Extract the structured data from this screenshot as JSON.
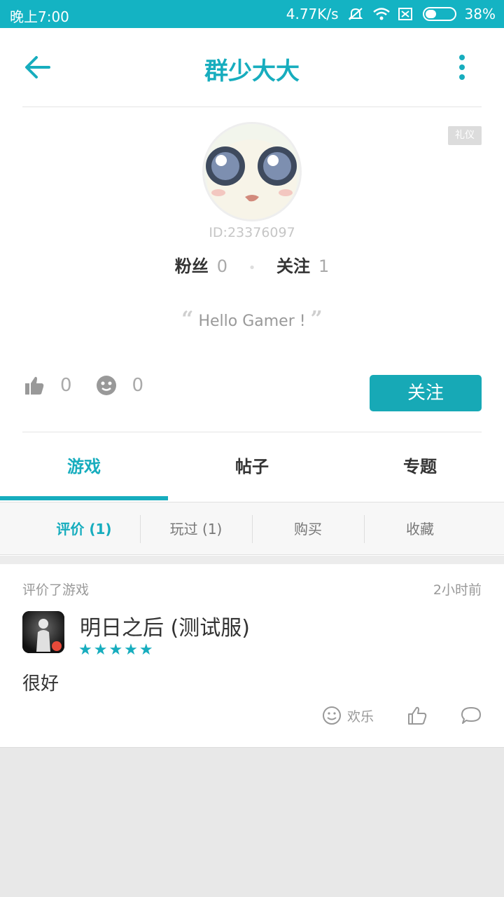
{
  "status_bar": {
    "time": "晚上7:00",
    "network_speed": "4.77K/s",
    "battery": "38%",
    "battery_level": 0.38,
    "icons": [
      "mute-icon",
      "wifi-icon",
      "sim-off-icon",
      "battery-icon"
    ]
  },
  "header": {
    "title": "群少大大",
    "back_icon": "back-arrow-icon",
    "more_icon": "more-vertical-icon",
    "accent_color": "#17adbe"
  },
  "profile": {
    "tag": "礼仪",
    "user_id": "ID:23376097",
    "fans_label": "粉丝",
    "fans_count": "0",
    "following_label": "关注",
    "following_count": "1",
    "quote_open": "“",
    "bio": "Hello Gamer !",
    "quote_close": "”",
    "likes_count": "0",
    "happy_count": "0",
    "follow_button": "关注"
  },
  "tabs": [
    {
      "label": "游戏",
      "active": true
    },
    {
      "label": "帖子",
      "active": false
    },
    {
      "label": "专题",
      "active": false
    }
  ],
  "subtabs": [
    {
      "label": "评价 (1)",
      "active": true
    },
    {
      "label": "玩过 (1)",
      "active": false
    },
    {
      "label": "购买",
      "active": false
    },
    {
      "label": "收藏",
      "active": false
    }
  ],
  "review": {
    "action": "评价了游戏",
    "time": "2小时前",
    "game_name": "明日之后 (测试服)",
    "stars": "★★★★★",
    "rating": 5,
    "text": "很好",
    "reaction_label": "欢乐"
  }
}
